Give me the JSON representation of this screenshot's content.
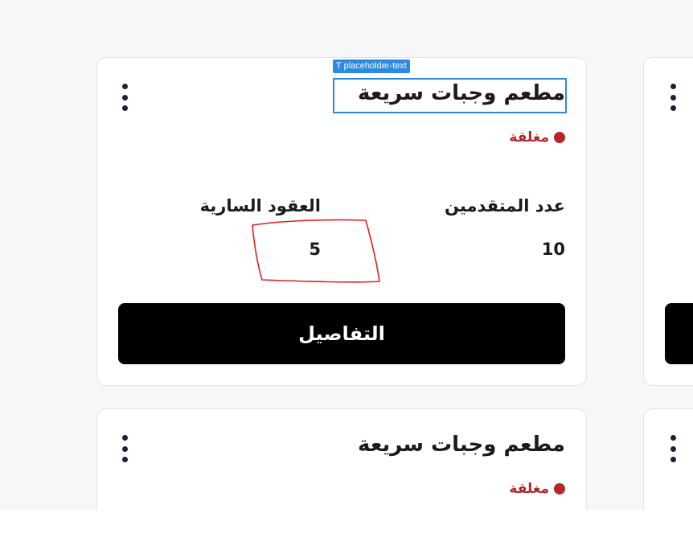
{
  "cards": [
    {
      "title": "مطعم وجبات سريعة",
      "status": "مغلقة",
      "applicants_label": "عدد المتقدمين",
      "applicants_value": "10",
      "contracts_label": "العقود السارية",
      "contracts_value": "5",
      "details_label": "التفاصيل"
    },
    {
      "title": "مطعم وجبات سريعة",
      "status": "مغلقة"
    }
  ],
  "editor": {
    "selection_tag": "placeholder-text",
    "selection_tag_icon": "T"
  },
  "colors": {
    "status_closed": "#b3262b",
    "button_bg": "#000000",
    "selection": "#2d8ae0",
    "annotation": "#e02020"
  }
}
